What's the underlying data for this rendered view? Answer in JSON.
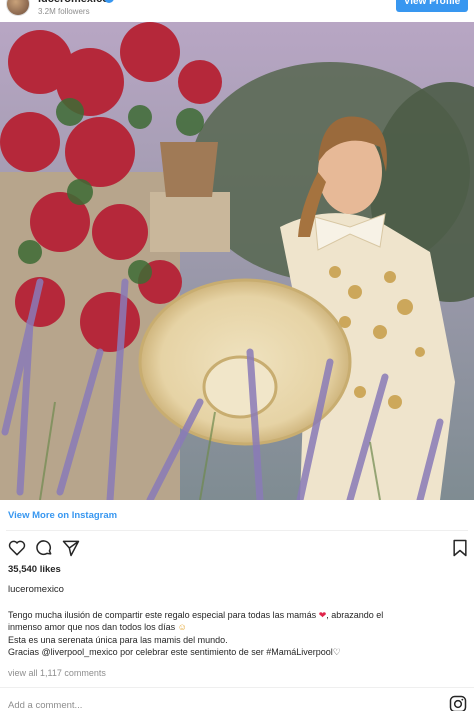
{
  "header": {
    "username": "luceromexico",
    "followers": "3.2M followers",
    "view_profile_label": "View Profile"
  },
  "view_more_label": "View More on Instagram",
  "likes": "35,540 likes",
  "author": "luceromexico",
  "caption": {
    "line1": "Tengo mucha ilusión de compartir este regalo especial para todas las mamás",
    "line1_end": ", abrazando el",
    "line2": "inmenso amor que nos dan todos los días",
    "line3": "Esta es una serenata única para las mamis del mundo.",
    "line4": "Gracias @liverpool_mexico por celebrar este sentimiento de ser #MamáLiverpool"
  },
  "view_all_comments": "view all 1,117 comments",
  "add_comment_placeholder": "Add a comment...",
  "colors": {
    "accent": "#3897f0",
    "text": "#262626",
    "muted": "#8e8e8e"
  },
  "icons": [
    "heart-icon",
    "comment-icon",
    "share-icon",
    "bookmark-icon",
    "instagram-icon"
  ]
}
